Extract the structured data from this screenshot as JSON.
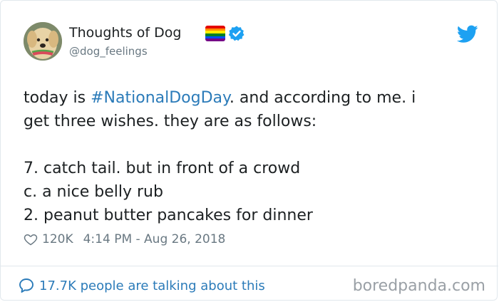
{
  "author": {
    "name": "Thoughts of Dog",
    "handle": "@dog_feelings",
    "avatar_icon": "dog-avatar-icon",
    "badges": [
      "rainbow-flag-icon",
      "verified-badge-icon"
    ]
  },
  "brand_icon": "twitter-bird-icon",
  "tweet": {
    "line1_pre": "today is ",
    "hashtag": "#NationalDogDay",
    "line1_post": ". and according to me. i",
    "line2": "get three wishes. they are as follows:",
    "wishes": [
      "7. catch tail. but in front of a crowd",
      "c. a nice belly rub",
      "2. peanut butter pancakes for dinner"
    ]
  },
  "meta": {
    "likes": "120K",
    "timestamp": "4:14 PM - Aug 26, 2018"
  },
  "footer": {
    "talking": "17.7K people are talking about this",
    "watermark": "boredpanda.com"
  },
  "colors": {
    "link": "#2b7bb9",
    "twitter_blue": "#1da1f2",
    "muted": "#697882",
    "text": "#1c2022"
  }
}
